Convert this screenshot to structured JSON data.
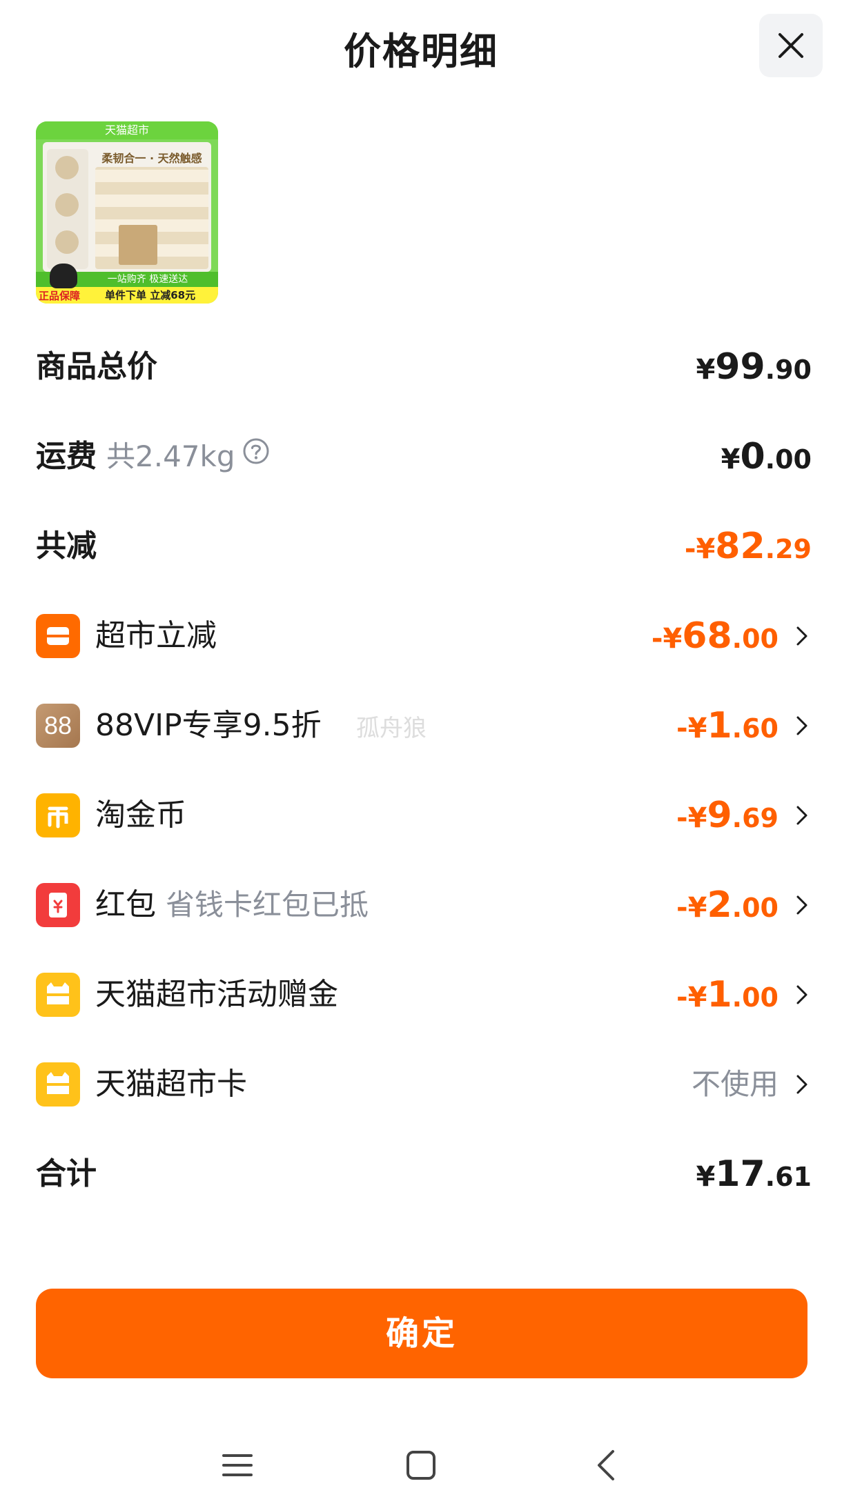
{
  "header": {
    "title": "价格明细"
  },
  "product": {
    "thumb_top": "天猫超市",
    "thumb_slogan": "柔韧合一 · 天然触感",
    "thumb_band": "一站购齐 极速送达",
    "thumb_promo": "单件下单 立减68元",
    "thumb_badge": "正品保障"
  },
  "rows": {
    "goods_total": {
      "label": "商品总价",
      "sym": "¥",
      "int": "99",
      "dec": ".90"
    },
    "shipping": {
      "label": "运费",
      "sub": "共2.47kg",
      "sym": "¥",
      "int": "0",
      "dec": ".00"
    },
    "total_discount": {
      "label": "共减",
      "sym": "-¥",
      "int": "82",
      "dec": ".29"
    },
    "supermarket_discount": {
      "label": "超市立减",
      "sym": "-¥",
      "int": "68",
      "dec": ".00"
    },
    "vip": {
      "icon_text": "88",
      "label": "88VIP专享9.5折",
      "sym": "-¥",
      "int": "1",
      "dec": ".60"
    },
    "coins": {
      "label": "淘金币",
      "sym": "-¥",
      "int": "9",
      "dec": ".69"
    },
    "red_packet": {
      "label": "红包",
      "sub": "省钱卡红包已抵",
      "sym": "-¥",
      "int": "2",
      "dec": ".00"
    },
    "activity_bonus": {
      "label": "天猫超市活动赠金",
      "sym": "-¥",
      "int": "1",
      "dec": ".00"
    },
    "supermarket_card": {
      "label": "天猫超市卡",
      "value": "不使用"
    },
    "grand_total": {
      "label": "合计",
      "sym": "¥",
      "int": "17",
      "dec": ".61"
    }
  },
  "watermark": "孤舟狼",
  "confirm_label": "确定",
  "colors": {
    "accent": "#ff6400",
    "discount_text": "#ff5f00",
    "muted_text": "#8a8f99"
  },
  "icons": {
    "close": "close-icon",
    "help": "question-circle-icon",
    "chevron": "chevron-right-icon",
    "nav": [
      "menu-icon",
      "home-square-icon",
      "back-chevron-icon"
    ]
  }
}
